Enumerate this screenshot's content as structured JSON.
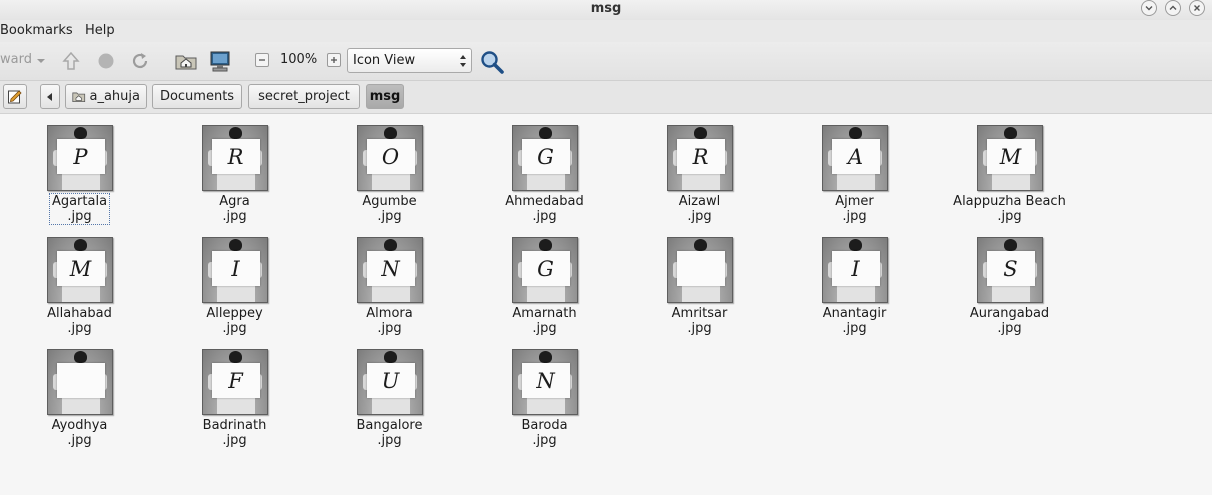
{
  "window": {
    "title": "msg"
  },
  "menubar": {
    "items": [
      "Bookmarks",
      "Help"
    ]
  },
  "toolbar": {
    "forward_label": "ward",
    "zoom_level": "100%",
    "view_mode": "Icon View"
  },
  "location": {
    "crumbs": [
      "a_ahuja",
      "Documents",
      "secret_project",
      "msg"
    ]
  },
  "files": [
    {
      "name": "Agartala",
      "ext": ".jpg",
      "letter": "P"
    },
    {
      "name": "Agra",
      "ext": ".jpg",
      "letter": "R"
    },
    {
      "name": "Agumbe",
      "ext": ".jpg",
      "letter": "O"
    },
    {
      "name": "Ahmedabad",
      "ext": ".jpg",
      "letter": "G"
    },
    {
      "name": "Aizawl",
      "ext": ".jpg",
      "letter": "R"
    },
    {
      "name": "Ajmer",
      "ext": ".jpg",
      "letter": "A"
    },
    {
      "name": "Alappuzha Beach",
      "ext": ".jpg",
      "letter": "M"
    },
    {
      "name": "Allahabad",
      "ext": ".jpg",
      "letter": "M"
    },
    {
      "name": "Alleppey",
      "ext": ".jpg",
      "letter": "I"
    },
    {
      "name": "Almora",
      "ext": ".jpg",
      "letter": "N"
    },
    {
      "name": "Amarnath",
      "ext": ".jpg",
      "letter": "G"
    },
    {
      "name": "Amritsar",
      "ext": ".jpg",
      "letter": ""
    },
    {
      "name": "Anantagir",
      "ext": ".jpg",
      "letter": "I"
    },
    {
      "name": "Aurangabad",
      "ext": ".jpg",
      "letter": "S"
    },
    {
      "name": "Ayodhya",
      "ext": ".jpg",
      "letter": ""
    },
    {
      "name": "Badrinath",
      "ext": ".jpg",
      "letter": "F"
    },
    {
      "name": "Bangalore",
      "ext": ".jpg",
      "letter": "U"
    },
    {
      "name": "Baroda",
      "ext": ".jpg",
      "letter": "N"
    }
  ]
}
